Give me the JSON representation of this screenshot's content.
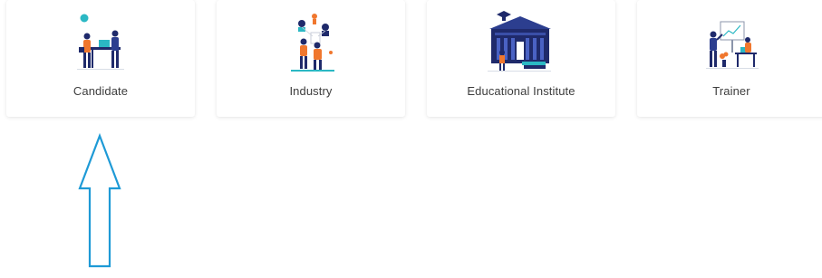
{
  "cards": [
    {
      "label": "Candidate",
      "illustration": "candidate-illustration"
    },
    {
      "label": "Industry",
      "illustration": "industry-illustration"
    },
    {
      "label": "Educational Institute",
      "illustration": "educational-institute-illustration"
    },
    {
      "label": "Trainer",
      "illustration": "trainer-illustration"
    }
  ],
  "annotation": {
    "icon": "up-arrow-icon",
    "color": "#1e9ad6"
  },
  "colors": {
    "navy": "#1f2a6b",
    "orange": "#f0772e",
    "teal": "#2bb8c4",
    "label_text": "#3d3d3d"
  }
}
